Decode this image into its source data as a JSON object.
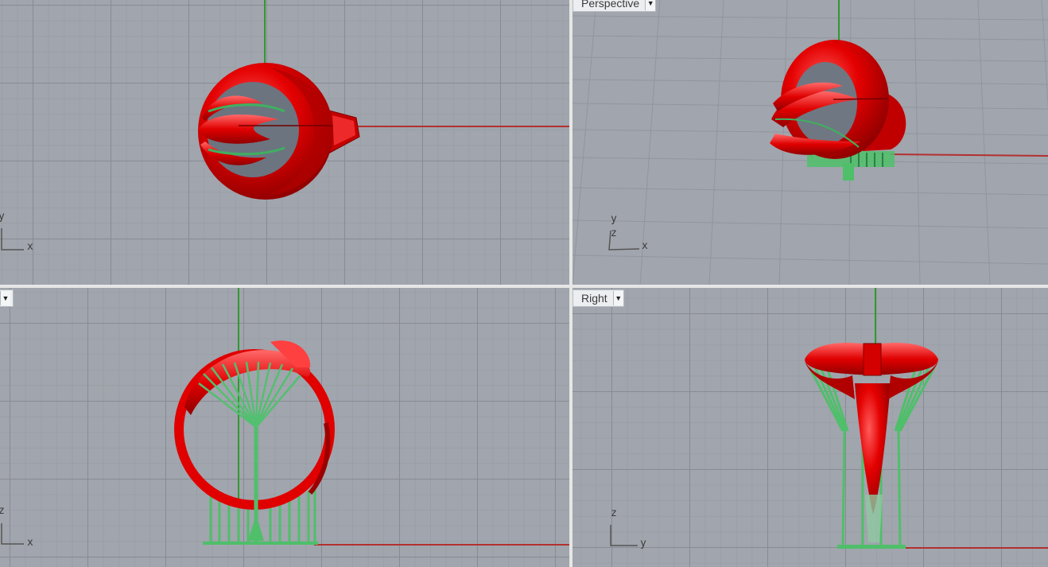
{
  "viewports": {
    "top": {
      "label": "",
      "axis_x": "x",
      "axis_y": "y"
    },
    "perspective": {
      "label": "Perspective",
      "axis_x": "x",
      "axis_y": "y",
      "axis_z": "z"
    },
    "front": {
      "label": "",
      "axis_x": "x",
      "axis_z": "z"
    },
    "right": {
      "label": "Right",
      "axis_y": "y",
      "axis_z": "z"
    }
  },
  "icons": {
    "viewport_menu": "dropdown-arrow-icon"
  },
  "colors": {
    "viewport_bg": "#a1a5ad",
    "model_red": "#e00000",
    "support_green": "#4fbf6a",
    "x_axis": "#b33030",
    "y_axis": "#2f9a2f",
    "separator": "#e6e6e6"
  }
}
